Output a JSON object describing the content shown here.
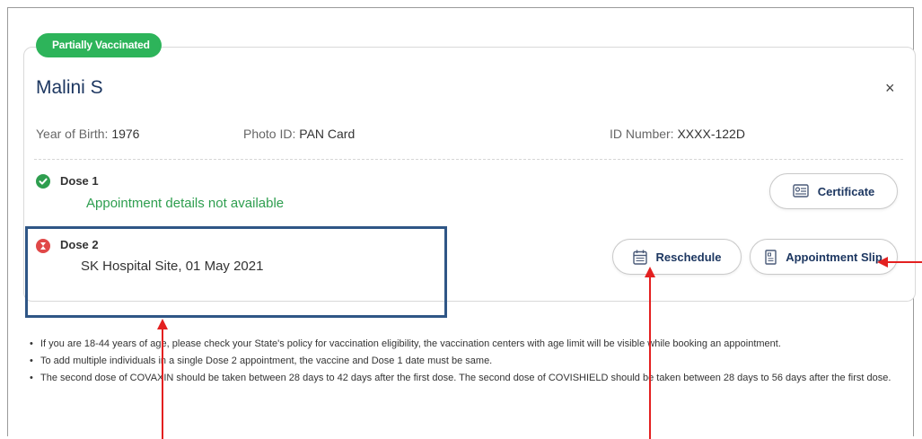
{
  "status_badge": "Partially Vaccinated",
  "beneficiary": {
    "name": "Malini S",
    "year_of_birth_label": "Year of Birth:",
    "year_of_birth": "1976",
    "photo_id_label": "Photo ID:",
    "photo_id": "PAN Card",
    "id_number_label": "ID Number:",
    "id_number": "XXXX-122D"
  },
  "close_label": "×",
  "dose1": {
    "title": "Dose 1",
    "detail": "Appointment details not available",
    "certificate_label": "Certificate"
  },
  "dose2": {
    "title": "Dose 2",
    "detail": "SK Hospital Site, 01 May 2021",
    "reschedule_label": "Reschedule",
    "appointment_slip_label": "Appointment Slip"
  },
  "notes": [
    "If you are 18-44 years of age, please check your State's policy for vaccination eligibility, the vaccination centers with age limit will be visible while booking an appointment.",
    "To add multiple individuals in a single Dose 2 appointment, the vaccine and Dose 1 date must be same.",
    "The second dose of COVAXIN should be taken between 28 days to 42 days after the first dose. The second dose of COVISHIELD should be taken between 28 days to 56 days after the first dose."
  ],
  "colors": {
    "status_green": "#2db45a",
    "dose1_green": "#2e9e4f",
    "dose2_red": "#e04848",
    "name_navy": "#1d3761",
    "highlight_box": "#2f5686",
    "annotation_arrow": "#e32020"
  }
}
